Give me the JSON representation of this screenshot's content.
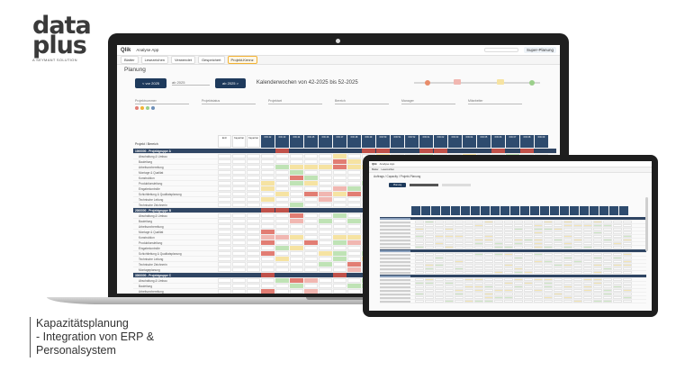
{
  "brand": {
    "line1": "data",
    "line2": "plus",
    "tagline": "A SEYMANT SOLUTION"
  },
  "app": {
    "name": "Analyse App",
    "sheet_tag": "Super-Planung"
  },
  "toolbar": {
    "items": [
      "Blatter",
      "Lesezeichen",
      "Verwendet",
      "Gespeichert",
      "Projekt-Kennz"
    ]
  },
  "sheet": {
    "title": "Planung",
    "prev_label": "< vor 2025",
    "date_label": "ab 2025",
    "next_label": "ab 2025 >",
    "weeks_title": "Kalenderwochen von 42-2025 bis 52-2025"
  },
  "filters": [
    "Projektnummer",
    "Projektstatus",
    "Projektart",
    "Bereich",
    "Manager",
    "Mitarbeiter"
  ],
  "grid": {
    "corner_label": "Projekt / Bereich",
    "column_headers": [
      "Einh",
      "Kapazitat",
      "Kapazitat",
      "KW 42",
      "KW 43",
      "KW 44",
      "KW 45",
      "KW 46",
      "KW 47",
      "KW 48",
      "KW 49",
      "KW 50",
      "KW 51",
      "KW 52",
      "KW 01",
      "KW 02",
      "KW 03",
      "KW 04",
      "KW 05",
      "KW 06",
      "KW 07",
      "KW 08",
      "KW 09"
    ],
    "groups": [
      {
        "name": "1000000 - Projektgruppe A",
        "rows": [
          "Abschaltung & Umbau",
          "Bauleitung",
          "Arbeitsvorbereitung",
          "Montage & Qualitat",
          "Konstruktion",
          "Produktionsleitung",
          "Eingabekontrolle",
          "Schichtleitung & Qualitatsplanung",
          "Technische Leitung",
          "Technische Zeichnerin"
        ]
      },
      {
        "name": "2000000 - Projektgruppe B",
        "rows": [
          "Abschaltung & Umbau",
          "Bauleitung",
          "Arbeitsvorbereitung",
          "Montage & Qualitat",
          "Konstruktion",
          "Produktionsleitung",
          "Eingabekontrolle",
          "Schichtleitung & Qualitatsplanung",
          "Technische Leitung",
          "Technische Zeichnerin",
          "Montageplanung"
        ]
      },
      {
        "name": "3000000 - Projektgruppe C",
        "rows": [
          "Abschaltung & Umbau",
          "Bauleitung",
          "Arbeitsvorbereitung",
          "Montage & Qualitat"
        ]
      }
    ]
  },
  "tablet": {
    "title": "Auftrags / Capacity / Projekt-Planung",
    "button_label": "Planung"
  },
  "caption": {
    "line1": "Kapazitätsplanung",
    "line2": "- Integration von ERP &",
    "line3": "Personalsystem"
  },
  "colors": {
    "header_blue": "#2e4b6e",
    "ok_green": "#bfe3b5",
    "warn_yellow": "#f6e3a2",
    "over_red": "#f1b7b1"
  }
}
